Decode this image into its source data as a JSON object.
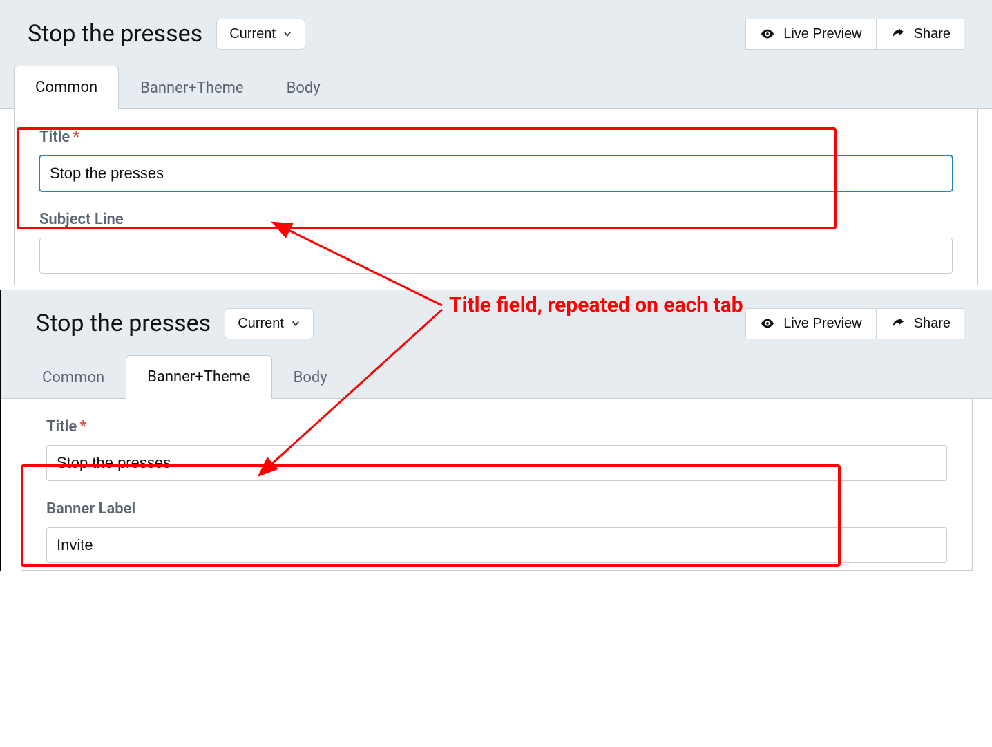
{
  "annotation": {
    "text": "Title field, repeated on each tab"
  },
  "panel1": {
    "header": {
      "title": "Stop the presses",
      "dropdown_label": "Current",
      "preview_label": "Live Preview",
      "share_label": "Share"
    },
    "tabs": {
      "t0": "Common",
      "t1": "Banner+Theme",
      "t2": "Body"
    },
    "form": {
      "title_label": "Title",
      "title_value": "Stop the presses",
      "subject_label": "Subject Line",
      "subject_value": ""
    }
  },
  "panel2": {
    "header": {
      "title": "Stop the presses",
      "dropdown_label": "Current",
      "preview_label": "Live Preview",
      "share_label": "Share"
    },
    "tabs": {
      "t0": "Common",
      "t1": "Banner+Theme",
      "t2": "Body"
    },
    "form": {
      "title_label": "Title",
      "title_value": "Stop the presses",
      "banner_label": "Banner Label",
      "banner_value": "Invite"
    }
  }
}
